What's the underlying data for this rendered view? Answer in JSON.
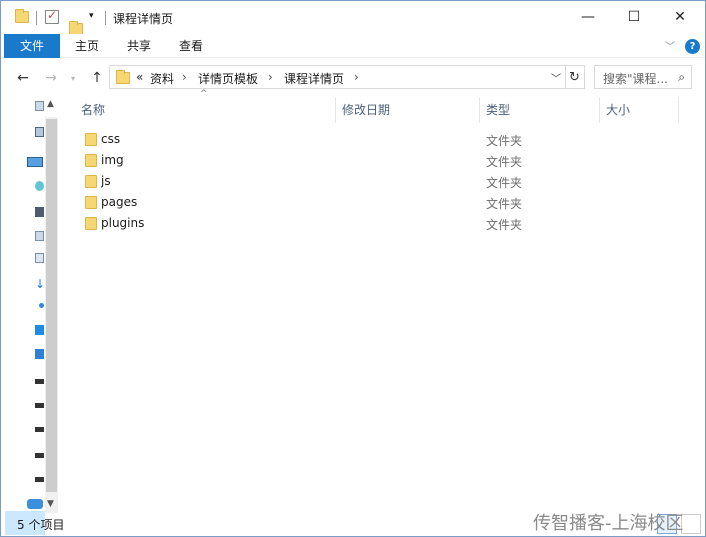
{
  "window": {
    "title": "课程详情页",
    "controls": {
      "minimize": "—",
      "maximize": "☐",
      "close": "✕"
    }
  },
  "ribbon": {
    "tabs": [
      "文件",
      "主页",
      "共享",
      "查看"
    ],
    "help_glyph": "?"
  },
  "address": {
    "prefix": "«",
    "crumbs": [
      "资料",
      "详情页模板",
      "课程详情页"
    ],
    "separator": "›"
  },
  "search": {
    "placeholder": "搜索\"课程..."
  },
  "columns": {
    "name": "名称",
    "modified": "修改日期",
    "type": "类型",
    "size": "大小"
  },
  "files": [
    {
      "name": "css",
      "type": "文件夹"
    },
    {
      "name": "img",
      "type": "文件夹"
    },
    {
      "name": "js",
      "type": "文件夹"
    },
    {
      "name": "pages",
      "type": "文件夹"
    },
    {
      "name": "plugins",
      "type": "文件夹"
    }
  ],
  "status": {
    "count_text": "5 个项目"
  },
  "watermark": "传智播客-上海校区",
  "colors": {
    "accent": "#1979ca",
    "folder": "#f7d774",
    "selection": "#cce8ff"
  },
  "icons": [
    "folder-icon",
    "checkmark-icon",
    "dropdown-icon",
    "back-arrow-icon",
    "forward-arrow-icon",
    "up-arrow-icon",
    "refresh-icon",
    "search-icon",
    "help-icon"
  ]
}
